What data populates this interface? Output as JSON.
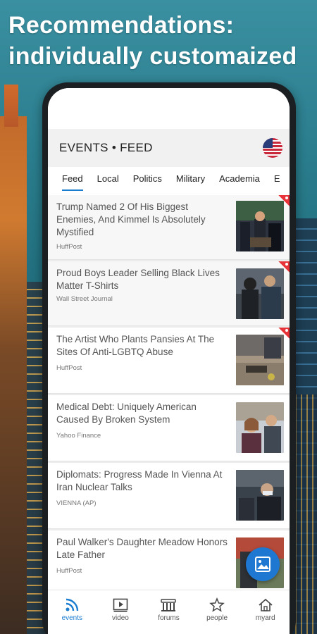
{
  "headline": {
    "line1": "Recommendations:",
    "line2": "individually customaized"
  },
  "app": {
    "title": "EVENTS • FEED",
    "flag_icon": "us-flag-icon"
  },
  "tabs": [
    "Feed",
    "Local",
    "Politics",
    "Military",
    "Academia",
    "E"
  ],
  "active_tab": "Feed",
  "articles": [
    {
      "title": "Trump Named 2 Of His Biggest Enemies, And Kimmel Is Absolutely Mystified",
      "source": "HuffPost",
      "is_new": true
    },
    {
      "title": "Proud Boys Leader Selling Black Lives Matter T-Shirts",
      "source": "Wall Street Journal",
      "is_new": true
    },
    {
      "title": "The Artist Who Plants Pansies At The Sites Of Anti-LGBTQ Abuse",
      "source": "HuffPost",
      "is_new": true
    },
    {
      "title": "Medical Debt: Uniquely American Caused By Broken System",
      "source": "Yahoo Finance",
      "is_new": false
    },
    {
      "title": "Diplomats: Progress Made In Vienna At Iran Nuclear Talks",
      "source": "VIENNA (AP)",
      "is_new": false
    },
    {
      "title": "Paul Walker's Daughter Meadow Honors Late Father",
      "source": "HuffPost",
      "is_new": false
    }
  ],
  "bottom_nav": [
    {
      "label": "events",
      "icon": "rss-icon",
      "active": true
    },
    {
      "label": "video",
      "icon": "play-icon",
      "active": false
    },
    {
      "label": "forums",
      "icon": "forum-icon",
      "active": false
    },
    {
      "label": "people",
      "icon": "star-people-icon",
      "active": false
    },
    {
      "label": "myard",
      "icon": "home-icon",
      "active": false
    }
  ],
  "colors": {
    "accent": "#1a7ccf",
    "new_badge": "#e8333b",
    "fab": "#1e78d2"
  }
}
